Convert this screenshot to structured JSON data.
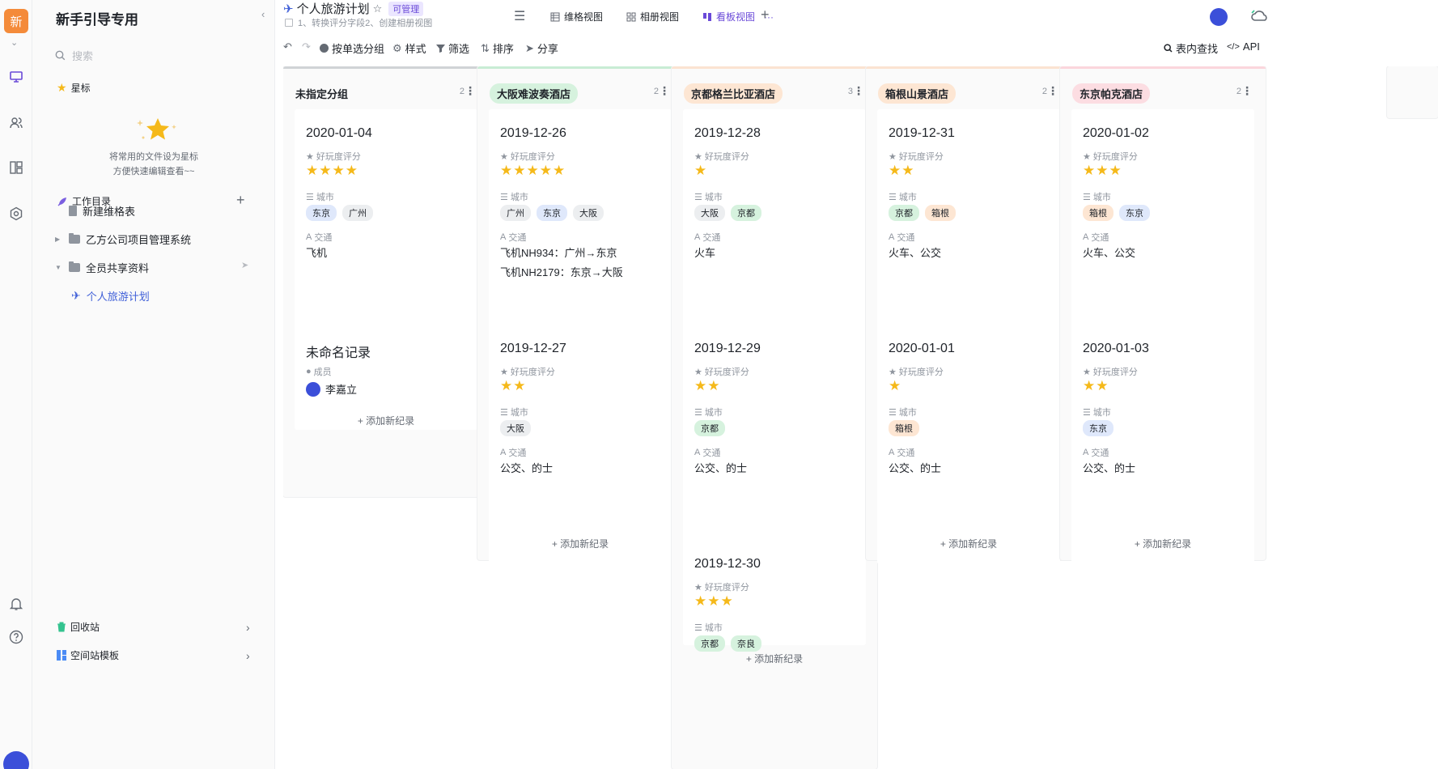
{
  "rail": {
    "logo_text": "新"
  },
  "sidebar": {
    "title": "新手引导专用",
    "search_placeholder": "搜索",
    "star_label": "星标",
    "star_hint_line1": "将常用的文件设为星标",
    "star_hint_line2": "方便快速编辑查看~~",
    "workdir_label": "工作目录",
    "tree": [
      {
        "label": "新建维格表"
      },
      {
        "label": "乙方公司项目管理系统"
      },
      {
        "label": "全员共享资料"
      },
      {
        "label": "个人旅游计划"
      }
    ],
    "recycle_label": "回收站",
    "template_label": "空间站模板"
  },
  "header": {
    "title": "个人旅游计划",
    "permission": "可管理",
    "description": "1、转换评分字段2、创建相册视图",
    "tabs": [
      {
        "label": "维格视图"
      },
      {
        "label": "相册视图"
      },
      {
        "label": "看板视图"
      }
    ]
  },
  "toolbar": {
    "group_label": "按单选分组",
    "style_label": "样式",
    "filter_label": "筛选",
    "sort_label": "排序",
    "share_label": "分享",
    "find_label": "表内查找",
    "api_label": "API"
  },
  "field_labels": {
    "rating": "好玩度评分",
    "city": "城市",
    "transport": "交通",
    "member": "成员"
  },
  "add_record_label": "添加新纪录",
  "colors": {
    "accent": "#6a4ad8",
    "star": "#f5b91a"
  },
  "columns": [
    {
      "name": "未指定分组",
      "count": "2",
      "cards": [
        {
          "title": "2020-01-04",
          "rating": "★★★★",
          "cities": [
            "东京",
            "广州"
          ],
          "transport_line1": "飞机",
          "transport_line2": ""
        },
        {
          "title": "未命名记录",
          "member": "李嘉立"
        }
      ]
    },
    {
      "name": "大阪难波奏酒店",
      "count": "2",
      "cards": [
        {
          "title": "2019-12-26",
          "rating": "★★★★★",
          "cities": [
            "广州",
            "东京",
            "大阪"
          ],
          "transport_line1": "飞机NH934：广州→东京",
          "transport_line2": "飞机NH2179：东京→大阪"
        },
        {
          "title": "2019-12-27",
          "rating": "★★",
          "cities": [
            "大阪"
          ],
          "transport_line1": "公交、的士",
          "transport_line2": ""
        }
      ]
    },
    {
      "name": "京都格兰比亚酒店",
      "count": "3",
      "cards": [
        {
          "title": "2019-12-28",
          "rating": "★",
          "cities": [
            "大阪",
            "京都"
          ],
          "transport_line1": "火车",
          "transport_line2": ""
        },
        {
          "title": "2019-12-29",
          "rating": "★★",
          "cities": [
            "京都"
          ],
          "transport_line1": "公交、的士",
          "transport_line2": ""
        },
        {
          "title": "2019-12-30",
          "rating": "★★★",
          "cities": [
            "京都",
            "奈良"
          ],
          "transport_line1": "",
          "transport_line2": ""
        }
      ]
    },
    {
      "name": "箱根山景酒店",
      "count": "2",
      "cards": [
        {
          "title": "2019-12-31",
          "rating": "★★",
          "cities": [
            "京都",
            "箱根"
          ],
          "transport_line1": "火车、公交",
          "transport_line2": ""
        },
        {
          "title": "2020-01-01",
          "rating": "★",
          "cities": [
            "箱根"
          ],
          "transport_line1": "公交、的士",
          "transport_line2": ""
        }
      ]
    },
    {
      "name": "东京帕克酒店",
      "count": "2",
      "cards": [
        {
          "title": "2020-01-02",
          "rating": "★★★",
          "cities": [
            "箱根",
            "东京"
          ],
          "transport_line1": "火车、公交",
          "transport_line2": ""
        },
        {
          "title": "2020-01-03",
          "rating": "★★",
          "cities": [
            "东京"
          ],
          "transport_line1": "公交、的士",
          "transport_line2": ""
        }
      ]
    }
  ]
}
